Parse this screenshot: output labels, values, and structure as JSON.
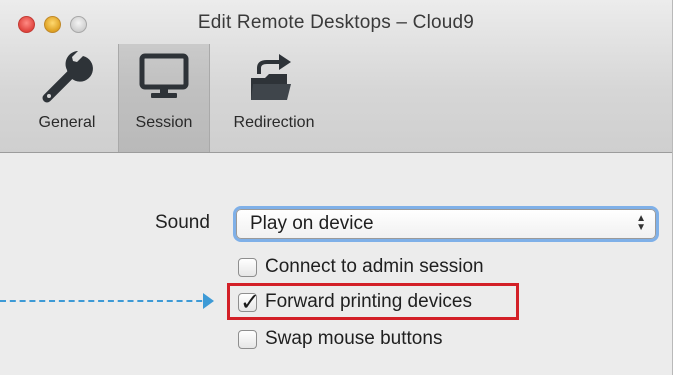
{
  "window": {
    "title": "Edit Remote Desktops – Cloud9"
  },
  "toolbar": {
    "items": [
      {
        "label": "General",
        "icon": "wrench-icon"
      },
      {
        "label": "Session",
        "icon": "monitor-icon",
        "selected": true
      },
      {
        "label": "Redirection",
        "icon": "folder-share-icon"
      }
    ]
  },
  "session": {
    "sound_label": "Sound",
    "sound_value": "Play on device",
    "options": [
      {
        "label": "Connect to admin session",
        "checked": false
      },
      {
        "label": "Forward printing devices",
        "checked": true,
        "highlighted": true
      },
      {
        "label": "Swap mouse buttons",
        "checked": false
      }
    ]
  },
  "colors": {
    "highlight": "#d32027",
    "pointer": "#3d9ad6",
    "focus_ring": "#7fb0e8"
  }
}
